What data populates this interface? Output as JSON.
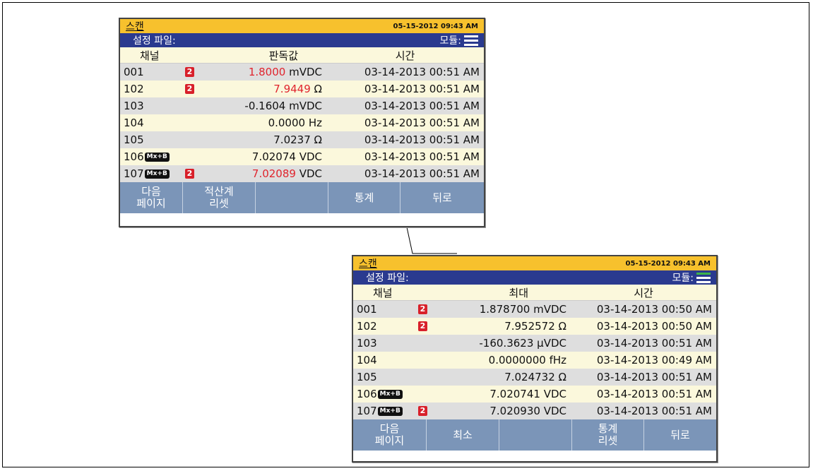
{
  "colors": {
    "title_bar": "#f7c12d",
    "config_bar": "#2a3a8f",
    "softkey_bar": "#7b95b8",
    "alarm": "#e0242d",
    "module_top": "#ffffff",
    "module_green": "#3cb44a"
  },
  "screens": [
    {
      "title": "스캔",
      "datetime": "05-15-2012 09:43 AM",
      "config_label": "설정 파일:",
      "module_label": "모듈:",
      "module_icon": "module-status-icon",
      "headers": {
        "channel": "채널",
        "value": "판독값",
        "time": "시간"
      },
      "rows": [
        {
          "channel": "001",
          "tag": "",
          "alarm": "2",
          "value": "1.8000",
          "unit": " mVDC",
          "red": true,
          "time": "03-14-2013 00:51 AM"
        },
        {
          "channel": "102",
          "tag": "",
          "alarm": "2",
          "value": "7.9449",
          "unit": " Ω",
          "red": true,
          "time": "03-14-2013 00:51 AM"
        },
        {
          "channel": "103",
          "tag": "",
          "alarm": "",
          "value": "-0.1604",
          "unit": " mVDC",
          "red": false,
          "time": "03-14-2013 00:51 AM"
        },
        {
          "channel": "104",
          "tag": "",
          "alarm": "",
          "value": "0.0000",
          "unit": " Hz",
          "red": false,
          "time": "03-14-2013 00:51 AM"
        },
        {
          "channel": "105",
          "tag": "",
          "alarm": "",
          "value": "7.0237",
          "unit": " Ω",
          "red": false,
          "time": "03-14-2013 00:51 AM"
        },
        {
          "channel": "106",
          "tag": "Mx+B",
          "alarm": "",
          "value": "7.02074",
          "unit": " VDC",
          "red": false,
          "time": "03-14-2013 00:51 AM"
        },
        {
          "channel": "107",
          "tag": "Mx+B",
          "alarm": "2",
          "value": "7.02089",
          "unit": " VDC",
          "red": true,
          "time": "03-14-2013 00:51 AM"
        }
      ],
      "softkeys": [
        "다음\n페이지",
        "적산계\n리셋",
        "",
        "통계",
        "뒤로"
      ]
    },
    {
      "title": "스캔",
      "datetime": "05-15-2012 09:43 AM",
      "config_label": "설정 파일:",
      "module_label": "모듈:",
      "module_icon": "module-status-icon",
      "headers": {
        "channel": "채널",
        "value": "최대",
        "time": "시간"
      },
      "rows": [
        {
          "channel": "001",
          "tag": "",
          "alarm": "2",
          "value": "1.878700",
          "unit": " mVDC",
          "red": false,
          "time": "03-14-2013 00:50 AM"
        },
        {
          "channel": "102",
          "tag": "",
          "alarm": "2",
          "value": "7.952572",
          "unit": " Ω",
          "red": false,
          "time": "03-14-2013 00:50 AM"
        },
        {
          "channel": "103",
          "tag": "",
          "alarm": "",
          "value": "-160.3623",
          "unit": " μVDC",
          "red": false,
          "time": "03-14-2013 00:51 AM"
        },
        {
          "channel": "104",
          "tag": "",
          "alarm": "",
          "value": "0.0000000",
          "unit": " fHz",
          "red": false,
          "time": "03-14-2013 00:49 AM"
        },
        {
          "channel": "105",
          "tag": "",
          "alarm": "",
          "value": "7.024732",
          "unit": " Ω",
          "red": false,
          "time": "03-14-2013 00:51 AM"
        },
        {
          "channel": "106",
          "tag": "Mx+B",
          "alarm": "",
          "value": "7.020741",
          "unit": " VDC",
          "red": false,
          "time": "03-14-2013 00:51 AM"
        },
        {
          "channel": "107",
          "tag": "Mx+B",
          "alarm": "2",
          "value": "7.020930",
          "unit": " VDC",
          "red": false,
          "time": "03-14-2013 00:51 AM"
        }
      ],
      "softkeys": [
        "다음\n페이지",
        "최소",
        "",
        "통계\n리셋",
        "뒤로"
      ]
    }
  ]
}
